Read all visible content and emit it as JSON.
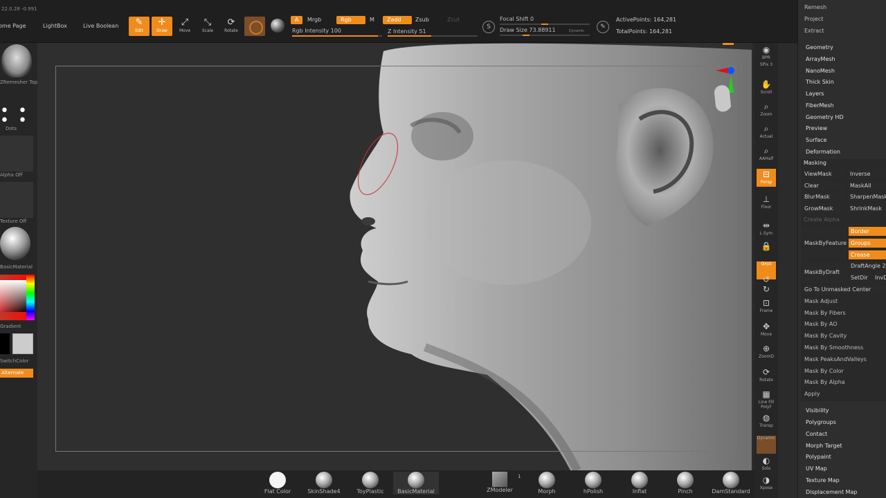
{
  "top": {
    "coords": "22.0.28 -0.991",
    "tabs": [
      "Home Page",
      "LightBox",
      "Live Boolean"
    ],
    "tools": [
      {
        "label": "Edit",
        "glyph": "✎",
        "active": true
      },
      {
        "label": "Draw",
        "glyph": "✛",
        "active": true
      },
      {
        "label": "Move",
        "glyph": "⤢",
        "active": false
      },
      {
        "label": "Scale",
        "glyph": "⤡",
        "active": false
      },
      {
        "label": "Rotate",
        "glyph": "⟳",
        "active": false
      }
    ],
    "modes": {
      "a": "A",
      "mrgb": "Mrgb",
      "rgb": "Rgb",
      "m": "M",
      "zadd": "Zadd",
      "zsub": "Zsub",
      "zcut": "Zcut"
    },
    "rgb_intensity": {
      "label": "Rgb Intensity 100",
      "value": 100
    },
    "z_intensity": {
      "label": "Z Intensity 51",
      "value": 51
    },
    "focal_shift": {
      "label": "Focal Shift 0",
      "value": 0
    },
    "draw_size": {
      "label": "Draw Size 73.88911",
      "value": 73.88911
    },
    "dynamic": "Dynamic",
    "active_points": "ActivePoints: 164,281",
    "total_points": "TotalPoints: 164,281"
  },
  "left": {
    "brush_label": "ZRemesher Topologic",
    "stroke_label": "Dots",
    "alpha_label": "Alpha Off",
    "texture_label": "Texture Off",
    "material_label": "BasicMaterial",
    "gradient_label": "Gradient",
    "switch_label": "SwitchColor",
    "alternate_label": "Alternate"
  },
  "right_shelf": [
    {
      "label": "BPR",
      "glyph": "◉",
      "state": ""
    },
    {
      "label": "SPix 3",
      "glyph": "",
      "state": ""
    },
    {
      "label": "Scroll",
      "glyph": "✋",
      "state": ""
    },
    {
      "label": "Zoom",
      "glyph": "⌕",
      "state": ""
    },
    {
      "label": "Actual",
      "glyph": "⌕",
      "state": ""
    },
    {
      "label": "AAHalf",
      "glyph": "⌕",
      "state": ""
    },
    {
      "label": "Persp",
      "glyph": "⊟",
      "state": "on"
    },
    {
      "label": "Floor",
      "glyph": "⊥",
      "state": ""
    },
    {
      "label": "L.Sym",
      "glyph": "⇹",
      "state": ""
    },
    {
      "label": "",
      "glyph": "🔒",
      "state": ""
    },
    {
      "label": "Qxyz",
      "glyph": "",
      "state": "on"
    },
    {
      "label": "",
      "glyph": "↺",
      "state": ""
    },
    {
      "label": "",
      "glyph": "↻",
      "state": ""
    },
    {
      "label": "Frame",
      "glyph": "⊡",
      "state": ""
    },
    {
      "label": "Move",
      "glyph": "✥",
      "state": ""
    },
    {
      "label": "ZoomD",
      "glyph": "⊕",
      "state": ""
    },
    {
      "label": "Rotate",
      "glyph": "⟳",
      "state": ""
    },
    {
      "label": "Line Fill PolyF",
      "glyph": "▦",
      "state": ""
    },
    {
      "label": "Transp",
      "glyph": "◍",
      "state": ""
    },
    {
      "label": "Dynamic",
      "glyph": "",
      "state": "brown"
    },
    {
      "label": "Solo",
      "glyph": "◐",
      "state": ""
    },
    {
      "label": "Xpose",
      "glyph": "◑",
      "state": ""
    }
  ],
  "palette": {
    "top_items": [
      "Remesh",
      "Project",
      "Extract"
    ],
    "sections": [
      "Geometry",
      "ArrayMesh",
      "NanoMesh",
      "Thick Skin",
      "Layers",
      "FiberMesh",
      "Geometry HD",
      "Preview",
      "Surface",
      "Deformation"
    ],
    "masking": {
      "title": "Masking",
      "pairs": [
        [
          "ViewMask",
          "Inverse"
        ],
        [
          "Clear",
          "MaskAll"
        ],
        [
          "BlurMask",
          "SharpenMask"
        ],
        [
          "GrowMask",
          "ShrinkMask"
        ]
      ],
      "create_alpha": "Create Alpha",
      "mask_by_feature": "MaskByFeature",
      "feature_options": [
        "Border",
        "Groups",
        "Crease"
      ],
      "mask_by_draft": "MaskByDraft",
      "draft_angle": "DraftAngle 2",
      "set_dir": "SetDir",
      "inv_dir": "InvDir",
      "items": [
        "Go To Unmasked Center",
        "Mask Adjust",
        "Mask By Fibers",
        "Mask By AO",
        "Mask By Cavity",
        "Mask By Smoothness",
        "Mask PeaksAndValleys",
        "Mask By Color",
        "Mask By Alpha",
        "Apply"
      ]
    },
    "bottom_sections": [
      "Visibility",
      "Polygroups",
      "Contact",
      "Morph Target",
      "Polypaint",
      "UV Map",
      "Texture Map",
      "Displacement Map"
    ]
  },
  "bottom": {
    "materials": [
      "Flat Color",
      "SkinShade4",
      "ToyPlastic",
      "BasicMaterial"
    ],
    "zmodeler": "ZModeler",
    "zmodeler_count": "1",
    "brushes": [
      "Morph",
      "hPolish",
      "Inflat",
      "Pinch",
      "DamStandard"
    ]
  },
  "colors": {
    "accent": "#f08c1c",
    "panel": "#2e2e2e",
    "viewport": "#2f2f2f",
    "cursor": "#c8323c",
    "gizmo_x": "#e01010",
    "gizmo_y": "#20d020",
    "gizmo_z": "#1050ff"
  }
}
